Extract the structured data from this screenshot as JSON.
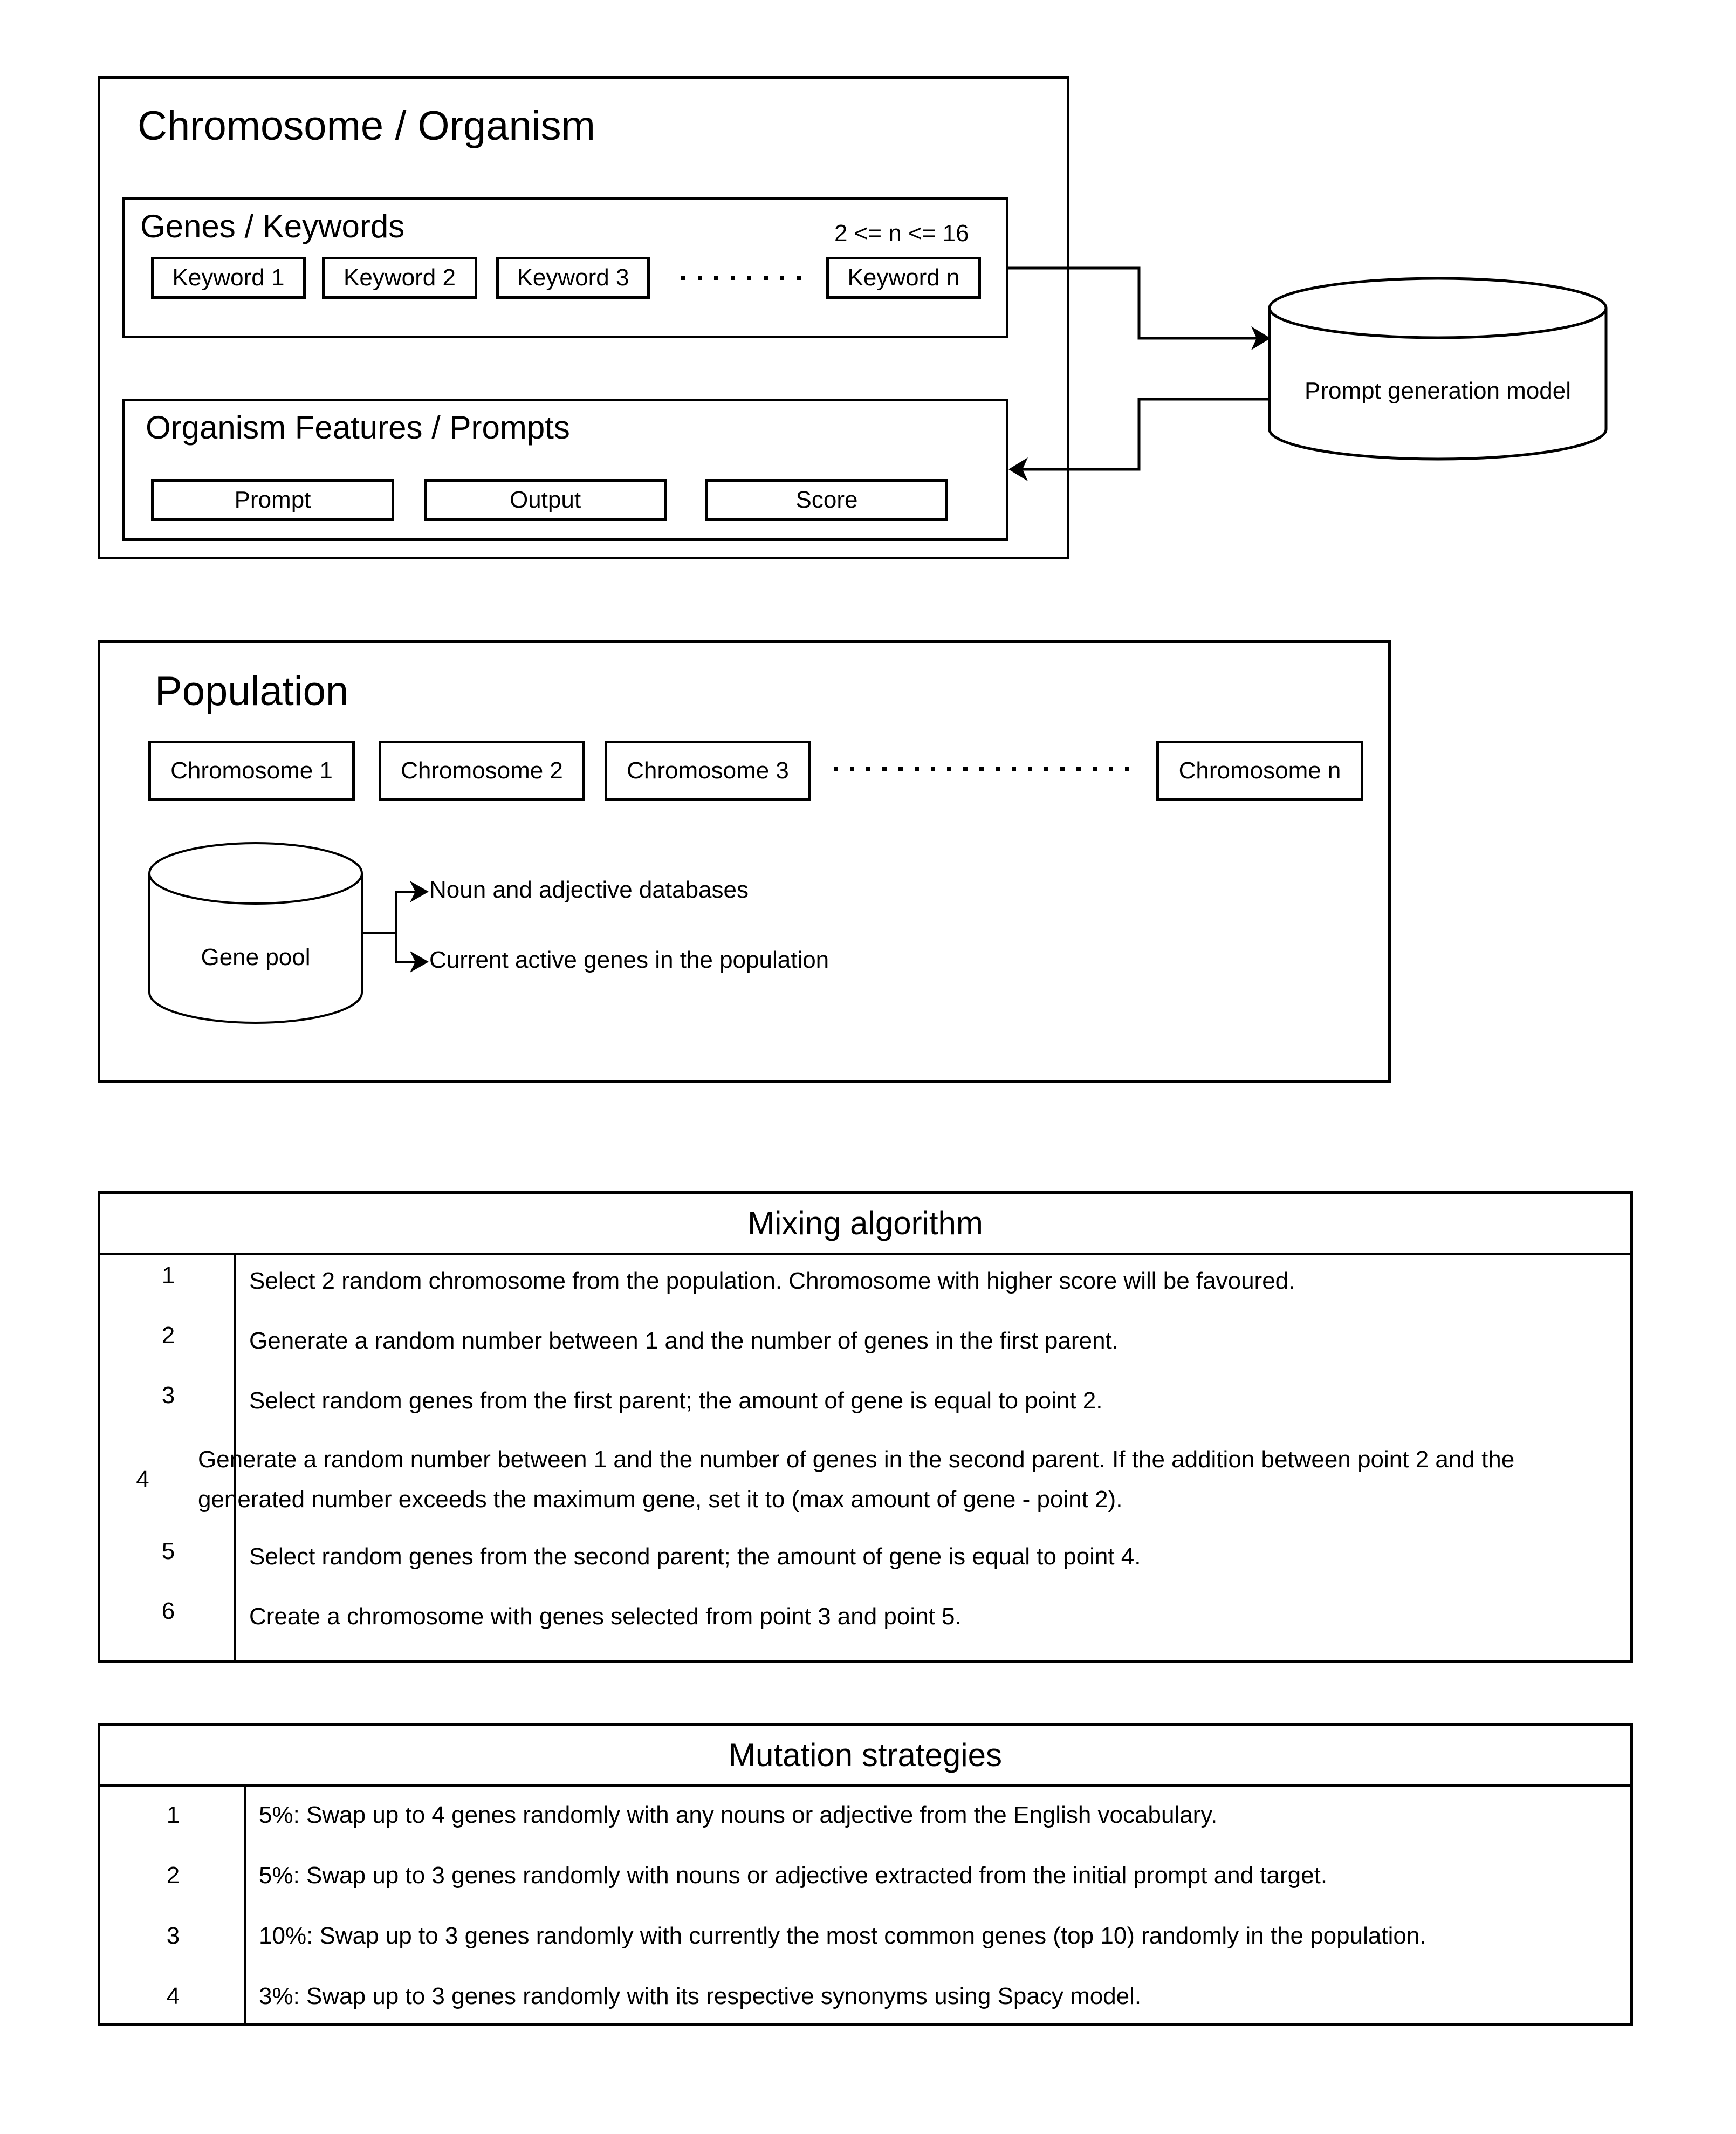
{
  "chromosome": {
    "title": "Chromosome / Organism",
    "genes": {
      "title": "Genes / Keywords",
      "constraint": "2 <= n <= 16",
      "keywords": [
        "Keyword 1",
        "Keyword 2",
        "Keyword 3",
        "Keyword n"
      ],
      "ellipsis": "........"
    },
    "features": {
      "title": "Organism Features / Prompts",
      "items": [
        "Prompt",
        "Output",
        "Score"
      ]
    }
  },
  "model": {
    "label": "Prompt generation model",
    "icon": "database-cylinder-icon"
  },
  "population": {
    "title": "Population",
    "chromosomes": [
      "Chromosome 1",
      "Chromosome 2",
      "Chromosome 3",
      "Chromosome n"
    ],
    "gene_pool": {
      "label": "Gene pool",
      "sources": [
        "Noun and adjective databases",
        "Current active genes in the population"
      ]
    }
  },
  "mixing": {
    "title": "Mixing algorithm",
    "steps": [
      {
        "n": "1",
        "text": "Select 2 random chromosome from the population. Chromosome with higher score will be favoured."
      },
      {
        "n": "2",
        "text": "Generate a random number between 1 and the number of genes in the first parent."
      },
      {
        "n": "3",
        "text": "Select random genes from the first parent; the amount of gene is equal to point 2."
      },
      {
        "n": "4",
        "text": "Generate a random number between 1 and the number of genes in the second parent. If the addition between point 2 and the generated number exceeds the maximum gene, set it to (max amount of gene - point 2)."
      },
      {
        "n": "5",
        "text": "Select random genes from the second parent; the amount of gene is equal to point 4."
      },
      {
        "n": "6",
        "text": "Create a chromosome with genes selected from point 3 and point 5."
      }
    ]
  },
  "mutation": {
    "title": "Mutation strategies",
    "steps": [
      {
        "n": "1",
        "text": "5%: Swap up to 4 genes randomly with any nouns or adjective from the English vocabulary."
      },
      {
        "n": "2",
        "text": "5%: Swap up to 3 genes randomly with nouns or adjective extracted from the initial prompt and target."
      },
      {
        "n": "3",
        "text": "10%: Swap up to 3 genes randomly with currently the most common genes (top 10) randomly in the population."
      },
      {
        "n": "4",
        "text": "3%: Swap up to 3 genes randomly with its respective synonyms using Spacy model."
      }
    ]
  }
}
